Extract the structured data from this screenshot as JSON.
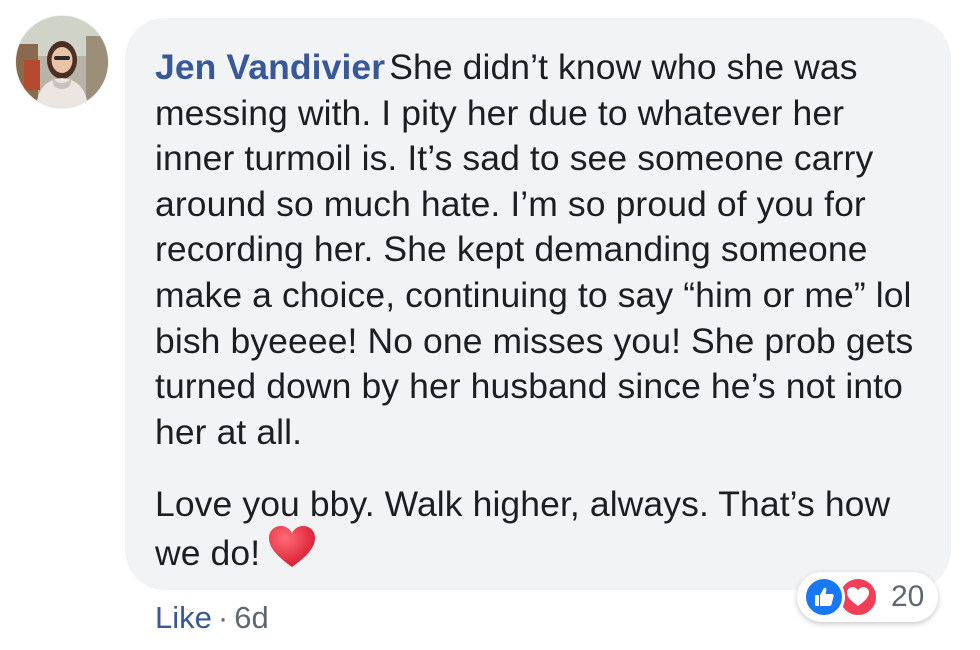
{
  "comment": {
    "author": "Jen Vandivier",
    "paragraph1": "She didn’t know who she was messing with. I pity her due to whatever her inner turmoil is. It’s sad to see someone carry around so much hate. I’m so proud of you for recording her. She kept demanding someone make a choice, continuing to say “him or me” lol bish byeeee! No one misses you! She prob gets turned down by her husband since he’s not into her at all.",
    "paragraph2": "Love you bby. Walk higher, always. That’s how we do!",
    "emoji": "red-heart-icon"
  },
  "actions": {
    "like_label": "Like",
    "separator": "·",
    "timestamp": "6d"
  },
  "reactions": {
    "icons": [
      "like-reaction-icon",
      "love-reaction-icon"
    ],
    "count": "20"
  },
  "colors": {
    "author": "#385898",
    "bubble": "#f2f3f5",
    "like_blue": "#1877f2",
    "love_red": "#f33e58",
    "meta_gray": "#606770",
    "heart": "#e0243a"
  }
}
